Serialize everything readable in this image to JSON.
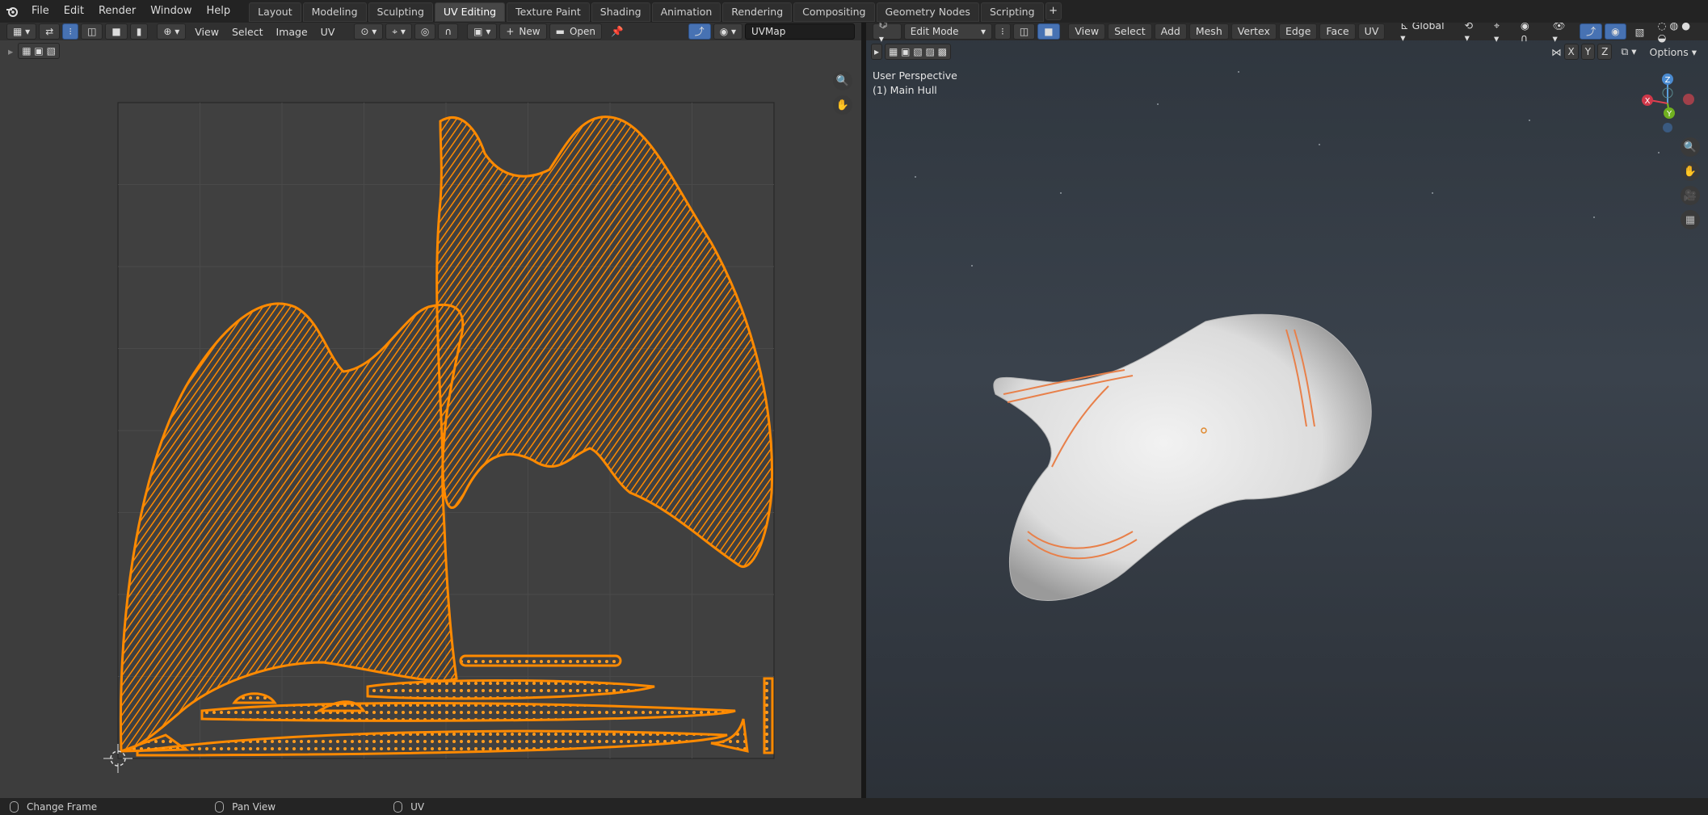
{
  "menu": {
    "items": [
      "File",
      "Edit",
      "Render",
      "Window",
      "Help"
    ]
  },
  "workspaces": {
    "tabs": [
      "Layout",
      "Modeling",
      "Sculpting",
      "UV Editing",
      "Texture Paint",
      "Shading",
      "Animation",
      "Rendering",
      "Compositing",
      "Geometry Nodes",
      "Scripting"
    ],
    "active": "UV Editing"
  },
  "uv_editor": {
    "menus": [
      "View",
      "Select",
      "Image",
      "UV"
    ],
    "new_label": "New",
    "open_label": "Open",
    "uvmap_name": "UVMap"
  },
  "viewport": {
    "mode": "Edit Mode",
    "menus": [
      "View",
      "Select",
      "Add",
      "Mesh",
      "Vertex",
      "Edge",
      "Face",
      "UV"
    ],
    "orientation": "Global",
    "overlay_line1": "User Perspective",
    "overlay_line2": "(1) Main Hull",
    "axes": [
      "X",
      "Y",
      "Z"
    ],
    "options_label": "Options",
    "gizmo": {
      "x": "X",
      "y": "Y",
      "z": "Z"
    }
  },
  "status": {
    "items": [
      "Change Frame",
      "Pan View",
      "UV"
    ]
  },
  "colors": {
    "accent": "#4772b3",
    "uv_orange": "#ff8a00",
    "mesh": "#e8e8e8"
  }
}
